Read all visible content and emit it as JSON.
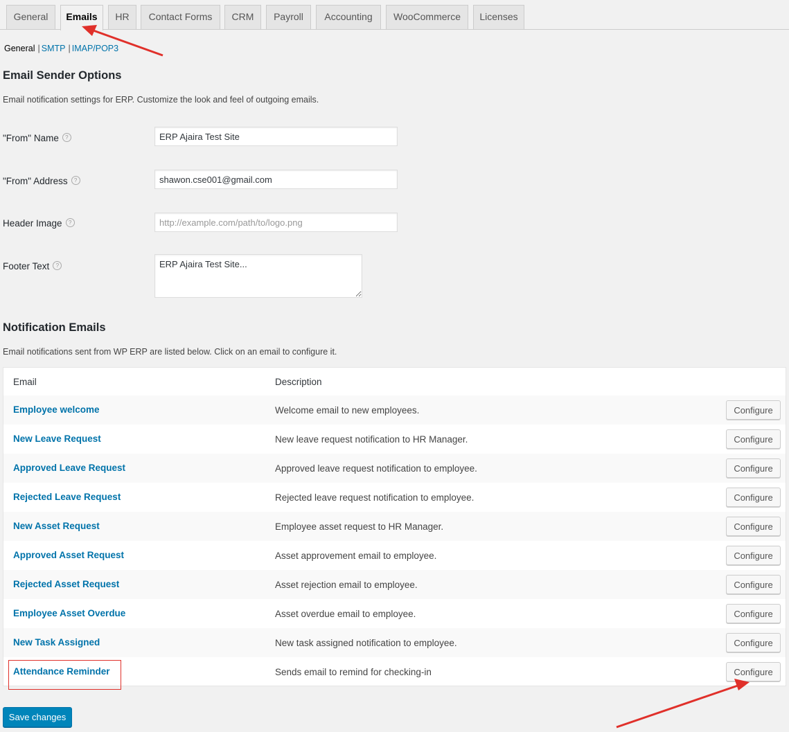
{
  "tabs": [
    {
      "label": "General",
      "active": false
    },
    {
      "label": "Emails",
      "active": true
    },
    {
      "label": "HR",
      "active": false
    },
    {
      "label": "Contact Forms",
      "active": false
    },
    {
      "label": "CRM",
      "active": false
    },
    {
      "label": "Payroll",
      "active": false
    },
    {
      "label": "Accounting",
      "active": false
    },
    {
      "label": "WooCommerce",
      "active": false
    },
    {
      "label": "Licenses",
      "active": false
    }
  ],
  "subnav": {
    "current": "General",
    "links": [
      "SMTP",
      "IMAP/POP3"
    ]
  },
  "sender": {
    "heading": "Email Sender Options",
    "description": "Email notification settings for ERP. Customize the look and feel of outgoing emails.",
    "from_name": {
      "label": "\"From\" Name",
      "value": "ERP Ajaira Test Site"
    },
    "from_address": {
      "label": "\"From\" Address",
      "value": "shawon.cse001@gmail.com"
    },
    "header_image": {
      "label": "Header Image",
      "value": "",
      "placeholder": "http://example.com/path/to/logo.png"
    },
    "footer_text": {
      "label": "Footer Text",
      "value": "ERP Ajaira Test Site..."
    },
    "help_glyph": "?"
  },
  "notifications": {
    "heading": "Notification Emails",
    "description": "Email notifications sent from WP ERP are listed below. Click on an email to configure it.",
    "columns": {
      "email": "Email",
      "description": "Description"
    },
    "configure_label": "Configure",
    "rows": [
      {
        "name": "Employee welcome",
        "description": "Welcome email to new employees."
      },
      {
        "name": "New Leave Request",
        "description": "New leave request notification to HR Manager."
      },
      {
        "name": "Approved Leave Request",
        "description": "Approved leave request notification to employee."
      },
      {
        "name": "Rejected Leave Request",
        "description": "Rejected leave request notification to employee."
      },
      {
        "name": "New Asset Request",
        "description": "Employee asset request to HR Manager."
      },
      {
        "name": "Approved Asset Request",
        "description": "Asset approvement email to employee."
      },
      {
        "name": "Rejected Asset Request",
        "description": "Asset rejection email to employee."
      },
      {
        "name": "Employee Asset Overdue",
        "description": "Asset overdue email to employee."
      },
      {
        "name": "New Task Assigned",
        "description": "New task assigned notification to employee."
      },
      {
        "name": "Attendance Reminder",
        "description": "Sends email to remind for checking-in"
      }
    ]
  },
  "save_label": "Save changes",
  "colors": {
    "link": "#0073aa",
    "primary": "#0085ba",
    "annotation": "#e0302a"
  }
}
